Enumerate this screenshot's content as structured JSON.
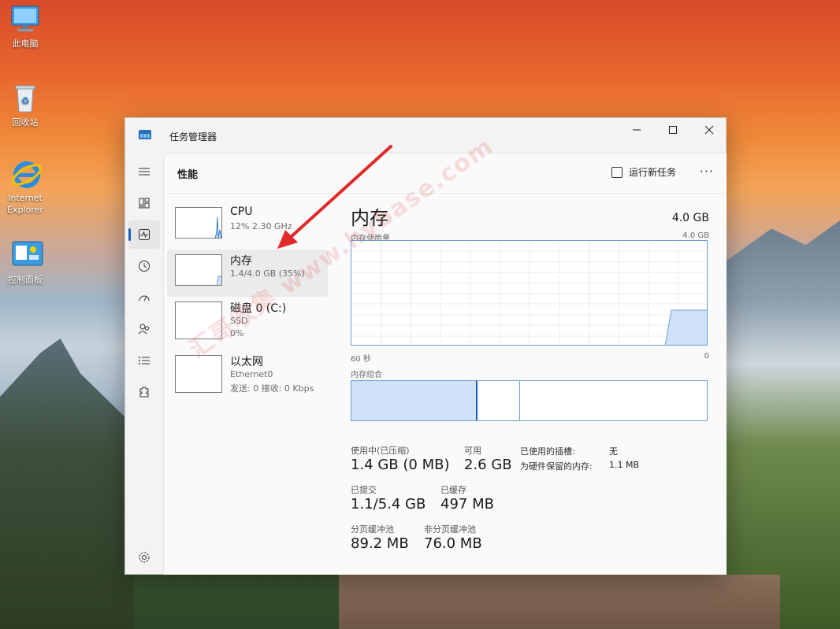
{
  "desktop": {
    "icons": [
      {
        "label": "此电脑"
      },
      {
        "label": "回收站"
      },
      {
        "label": "Internet\nExplorer"
      },
      {
        "label": "控制面板"
      }
    ]
  },
  "window": {
    "title": "任务管理器",
    "controls": {
      "minimize": "—",
      "maximize": "☐",
      "close": "✕"
    }
  },
  "header": {
    "page_title": "性能",
    "run_task_label": "运行新任务",
    "more_label": "···"
  },
  "nav": [
    {
      "icon": "hamburger-menu-icon"
    },
    {
      "icon": "processes-icon"
    },
    {
      "icon": "performance-icon",
      "active": true
    },
    {
      "icon": "app-history-icon"
    },
    {
      "icon": "startup-apps-icon"
    },
    {
      "icon": "users-icon"
    },
    {
      "icon": "details-icon"
    },
    {
      "icon": "services-icon"
    },
    {
      "icon": "settings-icon"
    }
  ],
  "resources": [
    {
      "title": "CPU",
      "line1": "12% 2.30 GHz",
      "line2": ""
    },
    {
      "title": "内存",
      "line1": "1.4/4.0 GB (35%)",
      "line2": ""
    },
    {
      "title": "磁盘 0 (C:)",
      "line1": "SSD",
      "line2": "0%"
    },
    {
      "title": "以太网",
      "line1": "Ethernet0",
      "line2": "发送: 0 接收: 0 Kbps"
    }
  ],
  "detail": {
    "title": "内存",
    "total": "4.0 GB",
    "graph_label": "内存使用量",
    "graph_max": "4.0 GB",
    "graph_time_left": "60 秒",
    "graph_time_right": "0",
    "composition_label": "内存组合",
    "composition": {
      "in_use_fraction": 0.35,
      "modified_fraction": 0.12
    },
    "stats": {
      "in_use_label": "使用中(已压缩)",
      "in_use_value": "1.4 GB (0 MB)",
      "available_label": "可用",
      "available_value": "2.6 GB",
      "committed_label": "已提交",
      "committed_value": "1.1/5.4 GB",
      "cached_label": "已缓存",
      "cached_value": "497 MB",
      "paged_label": "分页缓冲池",
      "paged_value": "89.2 MB",
      "nonpaged_label": "非分页缓冲池",
      "nonpaged_value": "76.0 MB",
      "slots_label": "已使用的插槽:",
      "slots_value": "无",
      "hw_reserved_label": "为硬件保留的内存:",
      "hw_reserved_value": "1.1 MB"
    }
  },
  "watermark": "汇哥收集 www.hybase.com",
  "colors": {
    "accent": "#1a5fb4",
    "graph_fill": "#cfe2f8",
    "graph_line": "#6e9ed6",
    "arrow": "#e02a2a"
  }
}
